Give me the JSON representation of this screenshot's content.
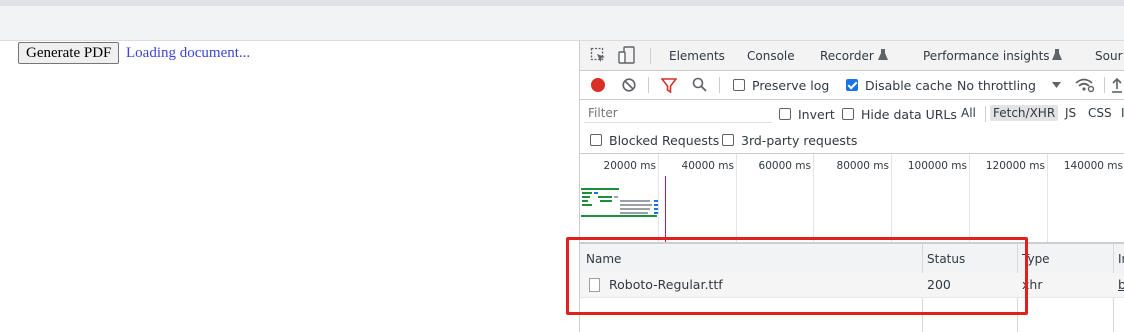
{
  "page": {
    "generate_button": "Generate PDF",
    "status_text": "Loading document..."
  },
  "devtools": {
    "tabs": [
      "Elements",
      "Console",
      "Recorder",
      "Performance insights",
      "Sour"
    ],
    "toolbar": {
      "preserve_log": "Preserve log",
      "disable_cache": "Disable cache",
      "throttling": "No throttling"
    },
    "filter": {
      "placeholder": "Filter",
      "invert": "Invert",
      "hide_data_urls": "Hide data URLs",
      "types": [
        "All",
        "Fetch/XHR",
        "JS",
        "CSS",
        "I"
      ]
    },
    "blocked": {
      "blocked_requests": "Blocked Requests",
      "third_party": "3rd-party requests"
    },
    "timeline": {
      "ticks": [
        "20000 ms",
        "40000 ms",
        "60000 ms",
        "80000 ms",
        "100000 ms",
        "120000 ms",
        "140000 ms"
      ]
    },
    "table": {
      "columns": [
        "Name",
        "Status",
        "Type",
        "In"
      ],
      "rows": [
        {
          "name": "Roboto-Regular.ttf",
          "status": "200",
          "type": "xhr",
          "initiator": "b"
        }
      ]
    }
  },
  "colors": {
    "accent_blue": "#1a73e8",
    "record_red": "#d93025",
    "highlight_red": "#e02020",
    "link_blue": "#3d45d8"
  },
  "icons": [
    "inspect-icon",
    "device-toolbar-icon",
    "flask-icon",
    "record-icon",
    "clear-icon",
    "filter-icon",
    "search-icon",
    "wifi-icon",
    "import-icon",
    "file-icon",
    "dropdown-arrow-icon"
  ]
}
